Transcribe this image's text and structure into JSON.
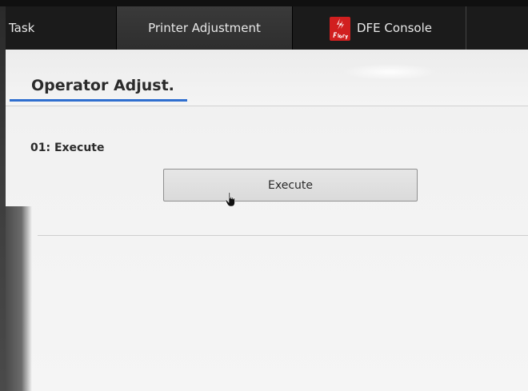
{
  "tabs": [
    {
      "label": "Task"
    },
    {
      "label": "Printer Adjustment"
    },
    {
      "label": "DFE Console",
      "icon": "fiery-logo-icon"
    }
  ],
  "section": {
    "title": "Operator Adjust."
  },
  "items": [
    {
      "label": "01:  Execute",
      "button_label": "Execute"
    }
  ],
  "colors": {
    "accent": "#2f6fcf",
    "fiery_red": "#d11f1f",
    "tabbar_bg": "#151515"
  }
}
